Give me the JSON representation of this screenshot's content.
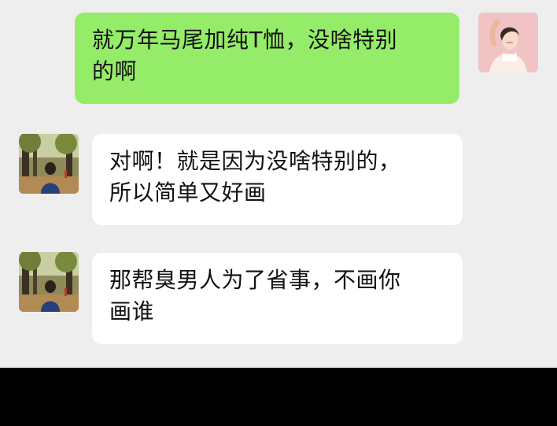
{
  "colors": {
    "chat_background": "#eeeeee",
    "sent_bubble": "#95ec69",
    "received_bubble": "#ffffff",
    "bottom_bar": "#000000"
  },
  "messages": [
    {
      "direction": "sent",
      "avatar": "woman-illustration-avatar",
      "lines": [
        "就万年马尾加纯T恤，没啥特别",
        "的啊"
      ]
    },
    {
      "direction": "received",
      "avatar": "autumn-park-photo-avatar",
      "lines": [
        "对啊！就是因为没啥特别的，",
        "所以简单又好画"
      ]
    },
    {
      "direction": "received",
      "avatar": "autumn-park-photo-avatar",
      "lines": [
        "那帮臭男人为了省事，不画你",
        "画谁"
      ]
    }
  ]
}
